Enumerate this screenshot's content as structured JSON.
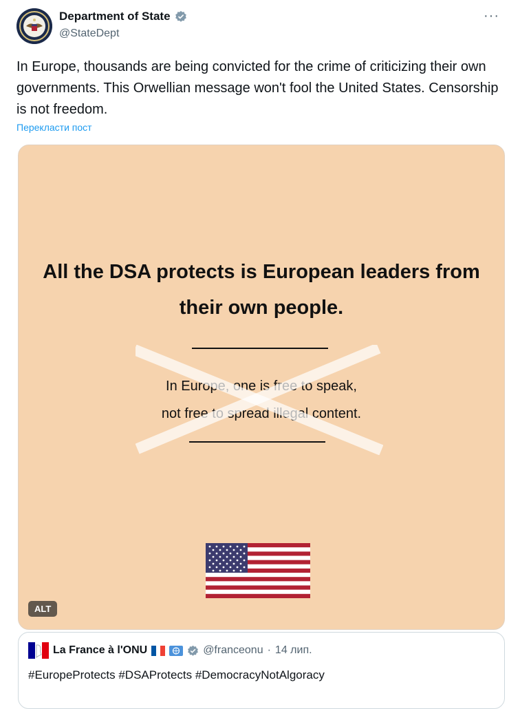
{
  "author": {
    "display_name": "Department of State",
    "handle": "@StateDept"
  },
  "tweet": {
    "text": "In Europe, thousands are being convicted for the crime of criticizing their own governments. This Orwellian message won't fool the United States. Censorship is not freedom.",
    "translate_label": "Перекласти пост"
  },
  "media": {
    "headline": "All the DSA protects is European leaders from their own people.",
    "crossed_line_1": "In Europe, one is free to speak,",
    "crossed_line_2": "not free to spread illegal content.",
    "alt_label": "ALT",
    "background_color": "#f6d3ae"
  },
  "quote": {
    "display_name": "La France à l'ONU",
    "handle": "@franceonu",
    "separator": "·",
    "date": "14 лип.",
    "text": "#EuropeProtects #DSAProtects #DemocracyNotAlgoracy"
  },
  "icons": {
    "verified": "verified-badge-icon",
    "more": "more-options-icon",
    "seal": "state-department-seal-icon"
  },
  "colors": {
    "link": "#1d9bf0",
    "secondary_text": "#536471",
    "verified_grey": "#829aab"
  }
}
